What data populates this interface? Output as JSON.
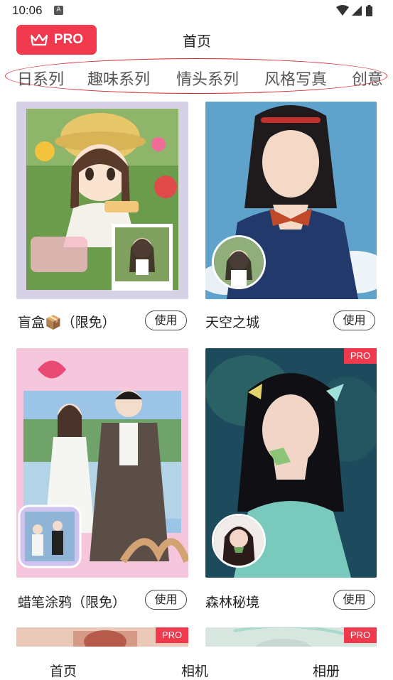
{
  "status_bar": {
    "time": "10:06",
    "notification_icon": "A"
  },
  "header": {
    "pro_label": "PRO",
    "title": "首页"
  },
  "tabs": [
    {
      "label": "日系列"
    },
    {
      "label": "趣味系列"
    },
    {
      "label": "情头系列"
    },
    {
      "label": "风格写真"
    },
    {
      "label": "创意"
    }
  ],
  "cards": [
    {
      "label": "盲盒📦（限免）",
      "button": "使用",
      "pro": false
    },
    {
      "label": "天空之城",
      "button": "使用",
      "pro": false
    },
    {
      "label": "蜡笔涂鸦（限免）",
      "button": "使用",
      "pro": false
    },
    {
      "label": "森林秘境",
      "button": "使用",
      "pro": true,
      "badge": "PRO"
    },
    {
      "label": "",
      "button": "",
      "pro": true,
      "badge": "PRO"
    },
    {
      "label": "",
      "button": "",
      "pro": true,
      "badge": "PRO"
    }
  ],
  "bottom_nav": [
    {
      "label": "首页"
    },
    {
      "label": "相机"
    },
    {
      "label": "相册"
    }
  ],
  "colors": {
    "accent": "#f0394d",
    "annotation": "#d8232a"
  }
}
